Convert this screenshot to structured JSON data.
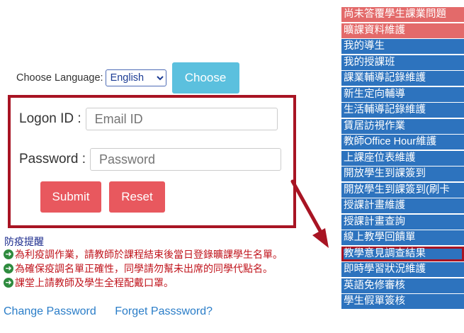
{
  "language": {
    "label": "Choose Language:",
    "selected": "English",
    "button": "Choose"
  },
  "login": {
    "logon_label": "Logon ID :",
    "logon_placeholder": "Email ID",
    "password_label": "Password :",
    "password_placeholder": "Password",
    "submit": "Submit",
    "reset": "Reset"
  },
  "notices": {
    "title": "防疫提醒",
    "items": [
      "為利疫調作業，請教師於課程結束後當日登錄曠課學生名單。",
      "為確保疫調名單正確性，同學請勿幫未出席的同學代點名。",
      "課堂上請教師及學生全程配戴口罩。"
    ],
    "icon": "arrow-right-circle-icon"
  },
  "links": {
    "change_password": "Change Password",
    "forget_password": "Forget Passsword?"
  },
  "menu": {
    "items": [
      "尚未答覆學生課業問題",
      "曠課資料維護",
      "我的導生",
      "我的授課班",
      "課業輔導記錄維護",
      "新生定向輔導",
      "生活輔導記錄維護",
      "賃居訪視作業",
      "教師Office Hour維護",
      "上課座位表維護",
      "開放學生到課簽到",
      "開放學生到課簽到(刷卡",
      "授課計畫維護",
      "授課計畫查詢",
      "線上教學回饋單",
      "教學意見調查結果",
      "即時學習狀況維護",
      "英語免修審核",
      "學生假單簽核"
    ]
  },
  "colors": {
    "menu_blue": "#2d73be",
    "menu_red": "#e36a6a",
    "highlight_border": "#a81423",
    "button_cyan": "#5bc0de",
    "button_red": "#e8585e"
  }
}
